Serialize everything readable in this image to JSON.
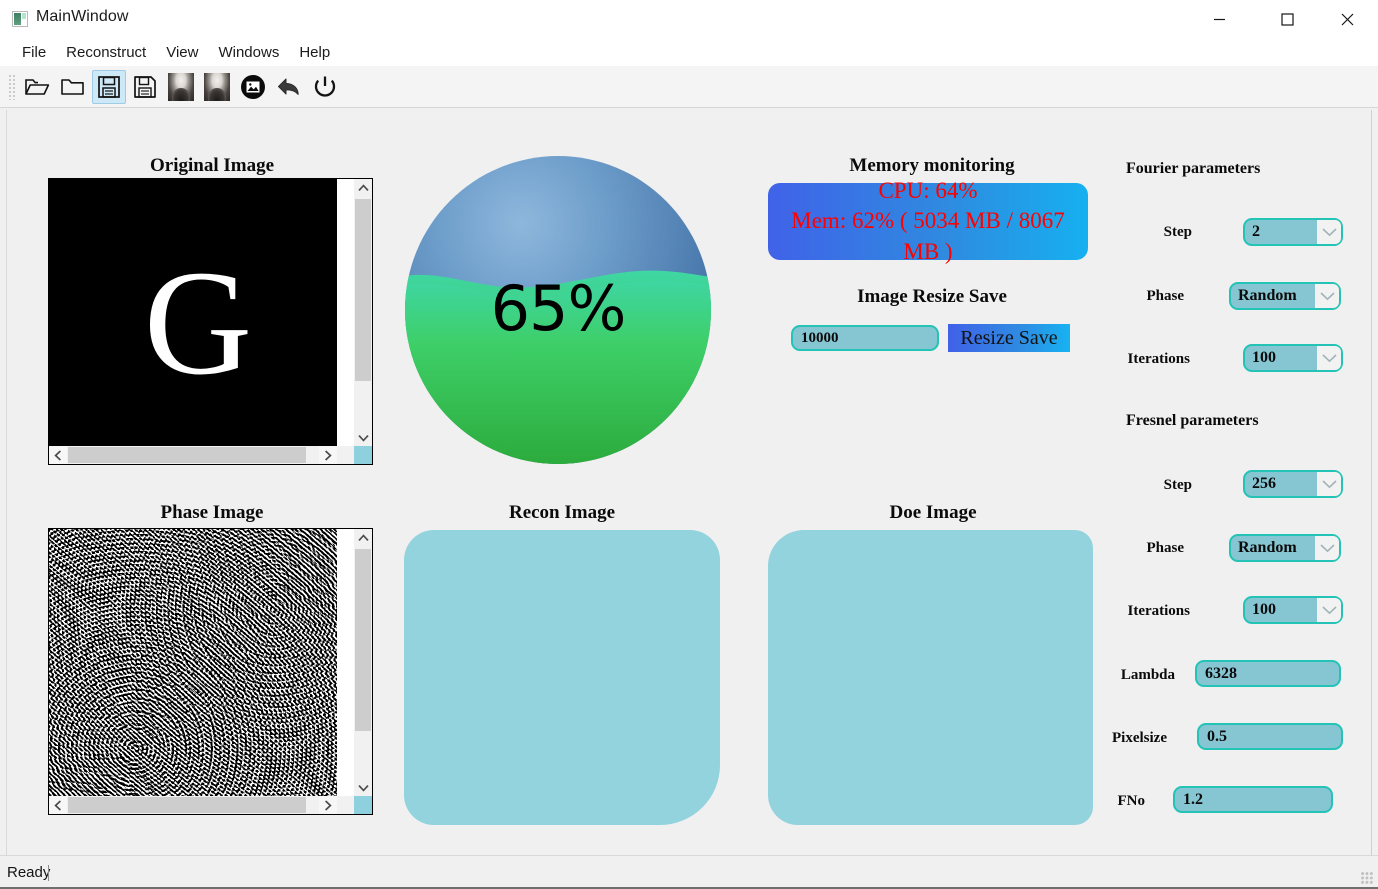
{
  "window": {
    "title": "MainWindow",
    "icon": "app-window-icon",
    "controls": {
      "minimize": "minimize-icon",
      "maximize": "maximize-icon",
      "close": "close-icon"
    }
  },
  "menubar": {
    "items": [
      {
        "label": "File"
      },
      {
        "label": "Reconstruct"
      },
      {
        "label": "View"
      },
      {
        "label": "Windows"
      },
      {
        "label": "Help"
      }
    ]
  },
  "toolbar": {
    "buttons": [
      {
        "icon": "open-folder-outline-icon",
        "selected": false
      },
      {
        "icon": "folder-icon",
        "selected": false
      },
      {
        "icon": "save-floppy-icon",
        "selected": true
      },
      {
        "icon": "save-as-floppy-icon",
        "selected": false
      },
      {
        "icon": "portrait-photo-icon",
        "selected": false
      },
      {
        "icon": "portrait-photo-2-icon",
        "selected": false
      },
      {
        "icon": "picture-circle-icon",
        "selected": false
      },
      {
        "icon": "undo-arrow-icon",
        "selected": false
      },
      {
        "icon": "power-icon",
        "selected": false
      }
    ]
  },
  "panels": {
    "original_image": {
      "title": "Original Image",
      "content": "G"
    },
    "phase_image": {
      "title": "Phase Image"
    },
    "recon_image": {
      "title": "Recon Image"
    },
    "doe_image": {
      "title": "Doe Image"
    }
  },
  "progress": {
    "percent_label": "65%",
    "percent_value": 65,
    "water_color": "#2fc24f",
    "sky_color": "#5f93c4"
  },
  "memory": {
    "title": "Memory monitoring",
    "cpu_line": "CPU: 64%",
    "mem_line": "Mem: 62% ( 5034 MB / 8067 MB )",
    "cpu_percent": 64,
    "mem_percent": 62,
    "mem_used_mb": 5034,
    "mem_total_mb": 8067,
    "text_color": "#ff0000"
  },
  "resize": {
    "title": "Image Resize Save",
    "value": "10000",
    "button_label": "Resize Save"
  },
  "parameters": {
    "fourier": {
      "group_title": "Fourier parameters",
      "rows": [
        {
          "label": "Step",
          "value": "2",
          "type": "combo"
        },
        {
          "label": "Phase",
          "value": "Random",
          "type": "combo"
        },
        {
          "label": "Iterations",
          "value": "100",
          "type": "combo"
        }
      ]
    },
    "fresnel": {
      "group_title": "Fresnel parameters",
      "rows": [
        {
          "label": "Step",
          "value": "256",
          "type": "combo"
        },
        {
          "label": "Phase",
          "value": "Random",
          "type": "combo"
        },
        {
          "label": "Iterations",
          "value": "100",
          "type": "combo"
        },
        {
          "label": "Lambda",
          "value": "6328",
          "type": "edit"
        },
        {
          "label": "Pixelsize",
          "value": "0.5",
          "type": "edit"
        },
        {
          "label": "FNo",
          "value": "1.2",
          "type": "edit"
        }
      ]
    }
  },
  "statusbar": {
    "text": "Ready"
  },
  "colors": {
    "accent_teal": "#23c3b6",
    "field_fill": "#86c5d2",
    "placeholder_box": "#92d3de",
    "window_bg": "#f0f0f0",
    "gradient_blue_start": "#4062e8",
    "gradient_blue_end": "#16b0f0"
  }
}
